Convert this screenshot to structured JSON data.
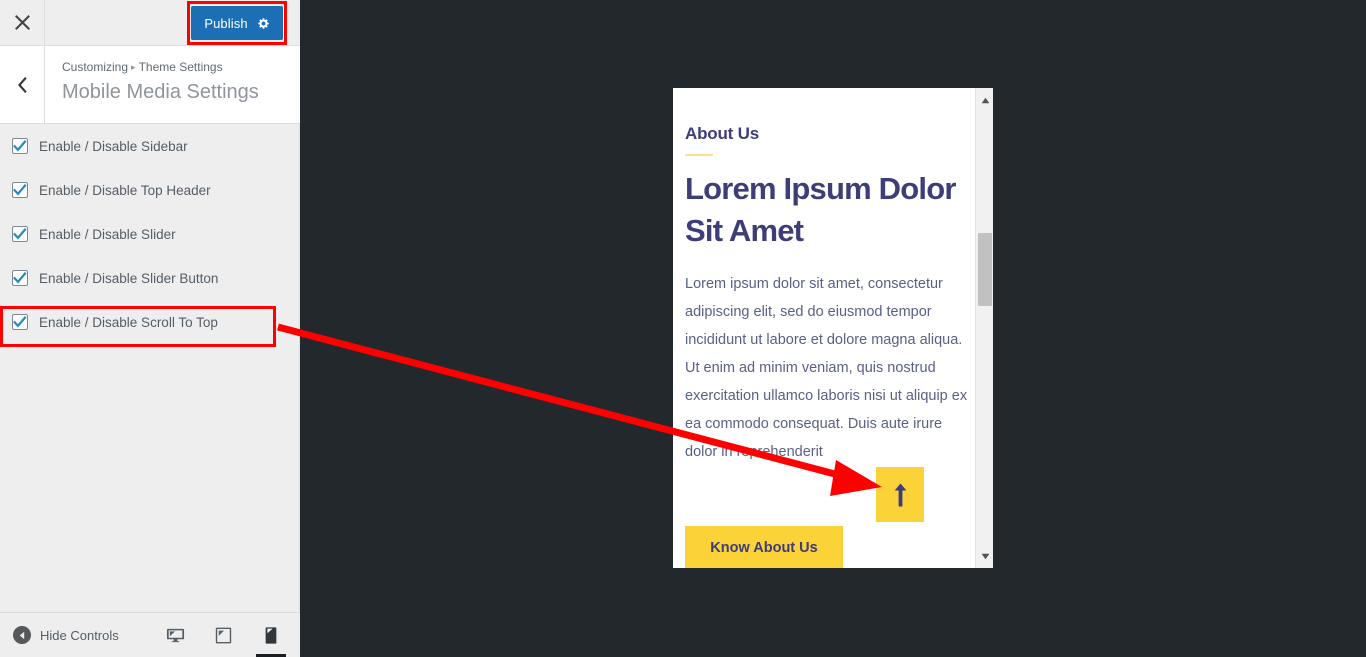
{
  "customizer": {
    "close_icon": "close-icon",
    "publish_label": "Publish",
    "publish_gear_icon": "gear-icon",
    "back_icon": "chevron-left-icon",
    "breadcrumb": {
      "root": "Customizing",
      "separator": "▸",
      "parent": "Theme Settings"
    },
    "section_title": "Mobile Media Settings",
    "controls": [
      {
        "label": "Enable / Disable Sidebar",
        "checked": true
      },
      {
        "label": "Enable / Disable Top Header",
        "checked": true
      },
      {
        "label": "Enable / Disable Slider",
        "checked": true
      },
      {
        "label": "Enable / Disable Slider Button",
        "checked": true
      },
      {
        "label": "Enable / Disable Scroll To Top",
        "checked": true
      }
    ],
    "footer": {
      "hide_controls_label": "Hide Controls",
      "collapse_icon": "collapse-left-icon",
      "devices": [
        {
          "name": "desktop-icon",
          "active": false
        },
        {
          "name": "tablet-icon",
          "active": false
        },
        {
          "name": "mobile-icon",
          "active": true
        }
      ]
    }
  },
  "preview": {
    "eyebrow": "About Us",
    "heading": "Lorem Ipsum Dolor Sit Amet",
    "body": "Lorem ipsum dolor sit amet, consectetur adipiscing elit, sed do eiusmod tempor incididunt ut labore et dolore magna aliqua. Ut enim ad minim veniam, quis nostrud exercitation ullamco laboris nisi ut aliquip ex ea commodo consequat. Duis aute irure dolor in reprehenderit",
    "cta_label": "Know About Us",
    "scroll_top_icon": "arrow-up-icon",
    "scrollbar": {
      "up_icon": "scroll-up-arrow-icon",
      "down_icon": "scroll-down-arrow-icon",
      "thumb": "scrollbar-thumb"
    }
  },
  "annotations": {
    "highlight_target": "Enable / Disable Scroll To Top",
    "arrow_color": "#ff0000",
    "highlight_color": "#ff0000"
  },
  "colors": {
    "publish_blue": "#1d6fb5",
    "accent_yellow": "#fcd239",
    "heading_navy": "#3d3d78",
    "panel_bg": "#eeeeee",
    "preview_bg": "#23282d"
  }
}
